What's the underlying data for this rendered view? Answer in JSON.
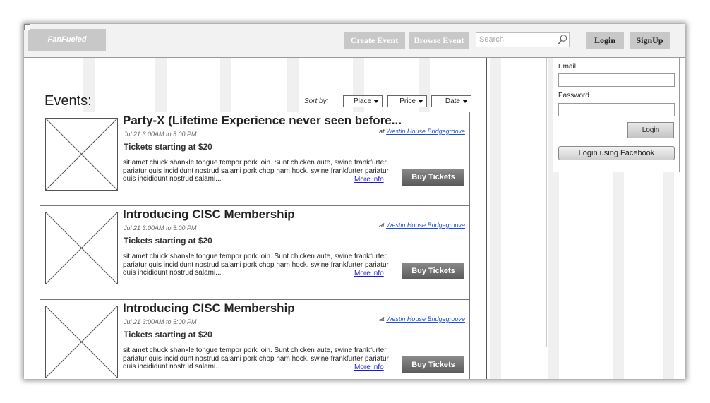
{
  "header": {
    "logo": "FanFueled",
    "create_event": "Create Event",
    "browse_event": "Browse Event",
    "search_placeholder": "Search",
    "login": "Login",
    "signup": "SignUp"
  },
  "login_panel": {
    "email_label": "Email",
    "password_label": "Password",
    "login_button": "Login",
    "facebook_button": "Login using Facebook"
  },
  "events": {
    "title": "Events:",
    "sort_label": "Sort by:",
    "sort_options": [
      "Place",
      "Price",
      "Date"
    ],
    "cards": [
      {
        "title": "Party-X (Lifetime Experience never seen before...",
        "date": "Jul 21 3:00AM to 5:00 PM",
        "venue_prefix": "at",
        "venue": "Westin House Bridgegroove",
        "tickets": "Tickets starting at $20",
        "description": "sit amet chuck shankle tongue tempor pork loin. Sunt chicken aute, swine frankfurter pariatur quis incididunt nostrud salami pork chop ham hock. swine frankfurter pariatur quis incididunt nostrud salami...",
        "more": "More info",
        "buy": "Buy Tickets"
      },
      {
        "title": "Introducing CISC Membership",
        "date": "Jul 21 3:00AM to 5:00 PM",
        "venue_prefix": "at",
        "venue": "Westin House Bridgegroove",
        "tickets": "Tickets starting at $20",
        "description": "sit amet chuck shankle tongue tempor pork loin. Sunt chicken aute, swine frankfurter pariatur quis incididunt nostrud salami pork chop ham hock. swine frankfurter pariatur quis incididunt nostrud salami...",
        "more": "More info",
        "buy": "Buy Tickets"
      },
      {
        "title": "Introducing CISC Membership",
        "date": "Jul 21 3:00AM to 5:00 PM",
        "venue_prefix": "at",
        "venue": "Westin House Bridgegroove",
        "tickets": "Tickets starting at $20",
        "description": "sit amet chuck shankle tongue tempor pork loin. Sunt chicken aute, swine frankfurter pariatur quis incididunt nostrud salami pork chop ham hock. swine frankfurter pariatur quis incididunt nostrud salami...",
        "more": "More info",
        "buy": "Buy Tickets"
      }
    ]
  }
}
